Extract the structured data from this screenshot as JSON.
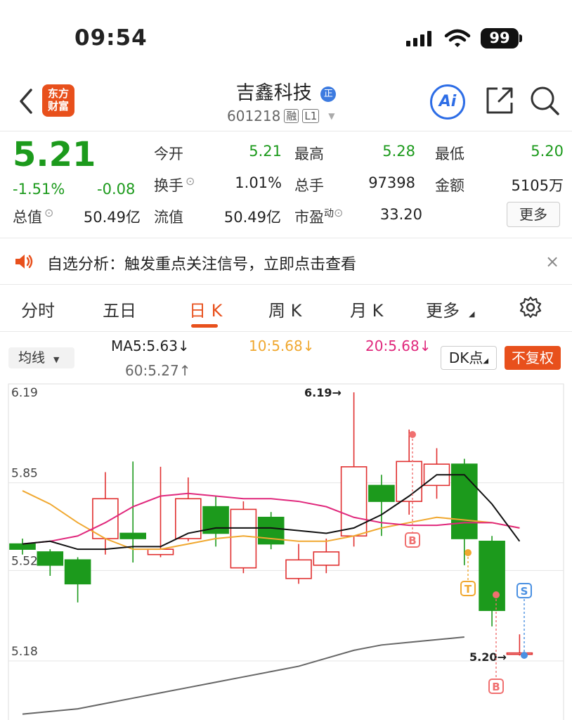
{
  "status_bar": {
    "time": "09:54",
    "battery": "99"
  },
  "header": {
    "title": "吉鑫科技",
    "title_badge": "正",
    "code": "601218",
    "tag_rong": "融",
    "tag_level": "L1",
    "logo_text_line1": "东方",
    "logo_text_line2": "财富",
    "ai_label": "Ai",
    "icons": [
      "back-arrow-icon",
      "share-icon",
      "search-icon"
    ]
  },
  "quote": {
    "price": "5.21",
    "change_pct": "-1.51%",
    "change_amt": "-0.08",
    "rows": [
      [
        {
          "label": "今开",
          "value": "5.21",
          "color": "#1c9a1c"
        },
        {
          "label": "最高",
          "value": "5.28",
          "color": "#1c9a1c"
        },
        {
          "label": "最低",
          "value": "5.20",
          "color": "#1c9a1c"
        }
      ],
      [
        {
          "label": "换手",
          "value": "1.01%",
          "color": "#222"
        },
        {
          "label": "总手",
          "value": "97398",
          "color": "#222"
        },
        {
          "label": "金额",
          "value": "5105万",
          "color": "#222"
        }
      ]
    ],
    "total_value_label": "总值",
    "total_value": "50.49亿",
    "float_value_label": "流值",
    "float_value": "50.49亿",
    "pe_label": "市盈",
    "pe_sup": "动",
    "pe_value": "33.20",
    "more_button": "更多"
  },
  "notice": {
    "text": "自选分析：触发重点关注信号，立即点击查看",
    "close": "×"
  },
  "tabs": [
    {
      "label": "分时",
      "active": false
    },
    {
      "label": "五日",
      "active": false
    },
    {
      "label": "日 K",
      "active": true
    },
    {
      "label": "周 K",
      "active": false
    },
    {
      "label": "月 K",
      "active": false
    },
    {
      "label": "更多",
      "active": false
    }
  ],
  "indicator_bar": {
    "select_label": "均线",
    "ma5": "MA5:5.63↓",
    "ma10": "10:5.68↓",
    "ma20": "20:5.68↓",
    "ma60": "60:5.27↑",
    "dk_button": "DK点",
    "fq_button": "不复权",
    "colors": {
      "ma5": "#111111",
      "ma10": "#f0a830",
      "ma20": "#e0287c",
      "ma60": "#666666"
    }
  },
  "chart_data": {
    "type": "candlestick",
    "y_axis_labels": [
      "6.19",
      "5.85",
      "5.52",
      "5.18"
    ],
    "ylim": [
      5.0,
      6.26
    ],
    "colors": {
      "up": "#e03030",
      "down": "#1c9a1c"
    },
    "candles": [
      {
        "o": 5.62,
        "c": 5.6,
        "h": 5.64,
        "l": 5.58
      },
      {
        "o": 5.59,
        "c": 5.54,
        "h": 5.6,
        "l": 5.5
      },
      {
        "o": 5.56,
        "c": 5.47,
        "h": 5.57,
        "l": 5.4
      },
      {
        "o": 5.64,
        "c": 5.79,
        "h": 5.89,
        "l": 5.58
      },
      {
        "o": 5.66,
        "c": 5.64,
        "h": 5.93,
        "l": 5.55
      },
      {
        "o": 5.58,
        "c": 5.6,
        "h": 5.91,
        "l": 5.57
      },
      {
        "o": 5.64,
        "c": 5.79,
        "h": 5.87,
        "l": 5.63
      },
      {
        "o": 5.76,
        "c": 5.66,
        "h": 5.8,
        "l": 5.61
      },
      {
        "o": 5.53,
        "c": 5.75,
        "h": 5.78,
        "l": 5.51
      },
      {
        "o": 5.72,
        "c": 5.62,
        "h": 5.74,
        "l": 5.6
      },
      {
        "o": 5.49,
        "c": 5.56,
        "h": 5.62,
        "l": 5.47
      },
      {
        "o": 5.54,
        "c": 5.59,
        "h": 5.64,
        "l": 5.51
      },
      {
        "o": 5.65,
        "c": 5.91,
        "h": 6.19,
        "l": 5.61
      },
      {
        "o": 5.84,
        "c": 5.78,
        "h": 5.88,
        "l": 5.65
      },
      {
        "o": 5.78,
        "c": 5.93,
        "h": 6.05,
        "l": 5.73
      },
      {
        "o": 5.84,
        "c": 5.92,
        "h": 5.98,
        "l": 5.79
      },
      {
        "o": 5.92,
        "c": 5.64,
        "h": 5.94,
        "l": 5.54
      },
      {
        "o": 5.63,
        "c": 5.37,
        "h": 5.65,
        "l": 5.31
      },
      {
        "o": 5.21,
        "c": 5.21,
        "h": 5.28,
        "l": 5.2
      }
    ],
    "ma5": [
      5.62,
      5.63,
      5.6,
      5.6,
      5.61,
      5.61,
      5.66,
      5.68,
      5.68,
      5.68,
      5.67,
      5.66,
      5.68,
      5.73,
      5.8,
      5.88,
      5.88,
      5.77,
      5.63
    ],
    "ma10": [
      5.82,
      5.77,
      5.7,
      5.64,
      5.6,
      5.6,
      5.62,
      5.64,
      5.65,
      5.64,
      5.63,
      5.63,
      5.65,
      5.68,
      5.7,
      5.72,
      5.71,
      5.7,
      5.68
    ],
    "ma20": [
      5.62,
      5.63,
      5.65,
      5.7,
      5.76,
      5.8,
      5.81,
      5.8,
      5.79,
      5.79,
      5.78,
      5.76,
      5.72,
      5.7,
      5.69,
      5.69,
      5.7,
      5.7,
      5.68
    ],
    "ma60": [
      4.98,
      4.99,
      5.0,
      5.02,
      5.04,
      5.06,
      5.08,
      5.1,
      5.12,
      5.14,
      5.16,
      5.19,
      5.22,
      5.24,
      5.25,
      5.26,
      5.27
    ],
    "annotations": [
      {
        "text": "6.19→"
      },
      {
        "text": "5.20→"
      }
    ],
    "signals": [
      {
        "label": "B",
        "color": "#f07070"
      },
      {
        "label": "T",
        "color": "#f0a830"
      },
      {
        "label": "S",
        "color": "#4a90e2"
      },
      {
        "label": "B",
        "color": "#f07070"
      }
    ]
  }
}
